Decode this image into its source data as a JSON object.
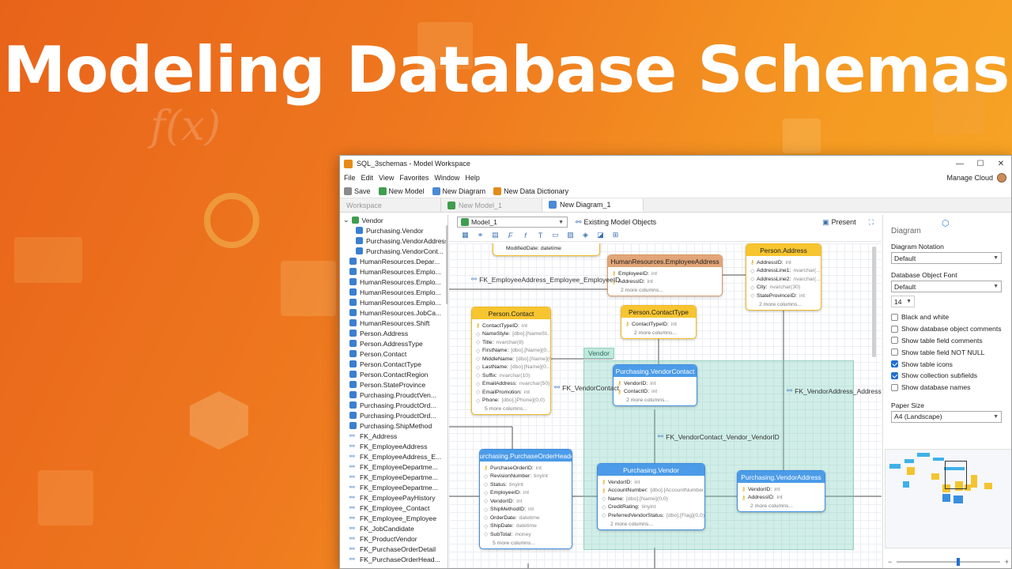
{
  "hero_title": "Modeling Database Schemas",
  "window": {
    "title": "SQL_3schemas - Model Workspace",
    "menu": [
      "File",
      "Edit",
      "View",
      "Favorites",
      "Window",
      "Help"
    ],
    "manage_cloud": "Manage Cloud"
  },
  "toolbar": {
    "save": "Save",
    "new_model": "New Model",
    "new_diagram": "New Diagram",
    "new_data_dictionary": "New Data Dictionary"
  },
  "tabs": [
    "Workspace",
    "New Model_1",
    "New Diagram_1"
  ],
  "tree": [
    {
      "label": "Vendor",
      "type": "folder"
    },
    {
      "label": "Purchasing.Vendor",
      "type": "table",
      "indent": 2
    },
    {
      "label": "Purchasing.VendorAddress",
      "type": "table",
      "indent": 2
    },
    {
      "label": "Purchasing.VendorCont...",
      "type": "table",
      "indent": 2
    },
    {
      "label": "HumanResources.Depar...",
      "type": "table",
      "indent": 1
    },
    {
      "label": "HumanResources.Emplo...",
      "type": "table",
      "indent": 1
    },
    {
      "label": "HumanResources.Emplo...",
      "type": "table",
      "indent": 1
    },
    {
      "label": "HumanResources.Emplo...",
      "type": "table",
      "indent": 1
    },
    {
      "label": "HumanResources.Emplo...",
      "type": "table",
      "indent": 1
    },
    {
      "label": "HumanResources.JobCa...",
      "type": "table",
      "indent": 1
    },
    {
      "label": "HumanResources.Shift",
      "type": "table",
      "indent": 1
    },
    {
      "label": "Person.Address",
      "type": "table",
      "indent": 1
    },
    {
      "label": "Person.AddressType",
      "type": "table",
      "indent": 1
    },
    {
      "label": "Person.Contact",
      "type": "table",
      "indent": 1
    },
    {
      "label": "Person.ContactType",
      "type": "table",
      "indent": 1
    },
    {
      "label": "Person.ContactRegion",
      "type": "table",
      "indent": 1
    },
    {
      "label": "Person.StateProvince",
      "type": "table",
      "indent": 1
    },
    {
      "label": "Purchasing.ProudctVen...",
      "type": "table",
      "indent": 1
    },
    {
      "label": "Purchasing.ProudctOrd...",
      "type": "table",
      "indent": 1
    },
    {
      "label": "Purchasing.ProudctOrd...",
      "type": "table",
      "indent": 1
    },
    {
      "label": "Purchasing.ShipMethod",
      "type": "table",
      "indent": 1
    },
    {
      "label": "FK_Address",
      "type": "fk",
      "indent": 1
    },
    {
      "label": "FK_EmployeeAddress",
      "type": "fk",
      "indent": 1
    },
    {
      "label": "FK_EmployeeAddress_E...",
      "type": "fk",
      "indent": 1
    },
    {
      "label": "FK_EmployeeDepartme...",
      "type": "fk",
      "indent": 1
    },
    {
      "label": "FK_EmployeeDepartme...",
      "type": "fk",
      "indent": 1
    },
    {
      "label": "FK_EmployeeDepartme...",
      "type": "fk",
      "indent": 1
    },
    {
      "label": "FK_EmployeePayHistory",
      "type": "fk",
      "indent": 1
    },
    {
      "label": "FK_Employee_Contact",
      "type": "fk",
      "indent": 1
    },
    {
      "label": "FK_Employee_Employee",
      "type": "fk",
      "indent": 1
    },
    {
      "label": "FK_JobCandidate",
      "type": "fk",
      "indent": 1
    },
    {
      "label": "FK_ProductVendor",
      "type": "fk",
      "indent": 1
    },
    {
      "label": "FK_PurchaseOrderDetail",
      "type": "fk",
      "indent": 1
    },
    {
      "label": "FK_PurchaseOrderHead...",
      "type": "fk",
      "indent": 1
    }
  ],
  "diagram_toolbar": {
    "model_select": "Model_1",
    "existing_objects": "Existing Model Objects",
    "present": "Present"
  },
  "group_label": "Vendor",
  "entities": [
    {
      "id": "emp_addr",
      "title": "HumanResources.EmployeeAddress",
      "color": "o",
      "fields": [
        {
          "k": true,
          "n": "EmployeeID:",
          "t": "int"
        },
        {
          "k": true,
          "n": "AddressID:",
          "t": "int"
        }
      ],
      "more": "2 more columns..."
    },
    {
      "id": "person_addr",
      "title": "Person.Address",
      "color": "y",
      "fields": [
        {
          "k": true,
          "n": "AddressID:",
          "t": "int"
        },
        {
          "k": false,
          "n": "AddressLine1:",
          "t": "nvarchar(..."
        },
        {
          "k": false,
          "n": "AddressLine2:",
          "t": "nvarchar(..."
        },
        {
          "k": false,
          "n": "City:",
          "t": "nvarchar(30)"
        },
        {
          "k": false,
          "n": "StateProvinceID:",
          "t": "int"
        }
      ],
      "more": "2 more columns..."
    },
    {
      "id": "person_contact",
      "title": "Person.Contact",
      "color": "y",
      "fields": [
        {
          "k": true,
          "n": "ContactTypeID:",
          "t": "int"
        },
        {
          "k": false,
          "n": "NameStyle:",
          "t": "[dbo].[NameSt..."
        },
        {
          "k": false,
          "n": "Title:",
          "t": "nvarchar(8)"
        },
        {
          "k": false,
          "n": "FirstName:",
          "t": "[dbo].[Name](0..."
        },
        {
          "k": false,
          "n": "MiddleName:",
          "t": "[dbo].[Name](0..."
        },
        {
          "k": false,
          "n": "LastName:",
          "t": "[dbo].[Name](0..."
        },
        {
          "k": false,
          "n": "Suffix:",
          "t": "nvarchar(10)"
        },
        {
          "k": false,
          "n": "EmailAddress:",
          "t": "nvarchar(50)"
        },
        {
          "k": false,
          "n": "EmailPromotion:",
          "t": "int"
        },
        {
          "k": false,
          "n": "Phone:",
          "t": "[dbo].[Phone](0,0)"
        }
      ],
      "more": "5 more columns..."
    },
    {
      "id": "contact_type",
      "title": "Person.ContactType",
      "color": "y",
      "fields": [
        {
          "k": true,
          "n": "ContactTypeID:",
          "t": "int"
        }
      ],
      "more": "2 more columns..."
    },
    {
      "id": "vendor_contact",
      "title": "Purchasing.VendorContact",
      "color": "b",
      "fields": [
        {
          "k": true,
          "n": "VendorID:",
          "t": "int"
        },
        {
          "k": true,
          "n": "ContactID:",
          "t": "int"
        }
      ],
      "more": "2 more columns..."
    },
    {
      "id": "po_header",
      "title": "Purchasing.PurchaseOrderHeader",
      "color": "b",
      "fields": [
        {
          "k": true,
          "n": "PurchaseOrderID:",
          "t": "int"
        },
        {
          "k": false,
          "n": "RevisionNumber:",
          "t": "tinyint"
        },
        {
          "k": false,
          "n": "Status:",
          "t": "tinyint"
        },
        {
          "k": false,
          "n": "EmployeeID:",
          "t": "int"
        },
        {
          "k": false,
          "n": "VendorID:",
          "t": "int"
        },
        {
          "k": false,
          "n": "ShipMethodID:",
          "t": "int"
        },
        {
          "k": false,
          "n": "OrderDate:",
          "t": "datetime"
        },
        {
          "k": false,
          "n": "ShipDate:",
          "t": "datetime"
        },
        {
          "k": false,
          "n": "SubTotal:",
          "t": "money"
        }
      ],
      "more": "5 more columns..."
    },
    {
      "id": "vendor",
      "title": "Purchasing.Vendor",
      "color": "b",
      "fields": [
        {
          "k": true,
          "n": "VendorID:",
          "t": "int"
        },
        {
          "k": true,
          "n": "AccountNumber:",
          "t": "[dbo].[AccountNumber..."
        },
        {
          "k": false,
          "n": "Name:",
          "t": "[dbo].[Name](0,0)"
        },
        {
          "k": false,
          "n": "CreditRating:",
          "t": "tinyint"
        },
        {
          "k": false,
          "n": "PreferredVendorStatus:",
          "t": "[dbo].[Flag](0,0)"
        }
      ],
      "more": "2 more columns..."
    },
    {
      "id": "vendor_addr",
      "title": "Purchasing.VendorAddress",
      "color": "b",
      "fields": [
        {
          "k": true,
          "n": "VendorID:",
          "t": "int"
        },
        {
          "k": true,
          "n": "AddressID:",
          "t": "int"
        }
      ],
      "more": "2 more columns..."
    }
  ],
  "top_partial_field": "ModifiedDate: datetime",
  "relations": {
    "fk_emp_addr": "FK_EmployeeAddress_Employee_EmployeeID",
    "fk_vendor_contact": "FK_VendorContact",
    "fk_vc_vendor": "FK_VendorContact_Vendor_VendorID",
    "fk_va": "FK_VendorAddress_Address"
  },
  "right_panel": {
    "title": "Diagram",
    "notation_label": "Diagram Notation",
    "notation_value": "Default",
    "font_label": "Database Object Font",
    "font_value": "Default",
    "font_size": "14",
    "checks": [
      {
        "label": "Black and white",
        "checked": false
      },
      {
        "label": "Show database object comments",
        "checked": false
      },
      {
        "label": "Show table field comments",
        "checked": false
      },
      {
        "label": "Show table field NOT NULL",
        "checked": false
      },
      {
        "label": "Show table icons",
        "checked": true
      },
      {
        "label": "Show collection subfields",
        "checked": true
      },
      {
        "label": "Show database names",
        "checked": false
      }
    ],
    "paper_label": "Paper Size",
    "paper_value": "A4 (Landscape)"
  }
}
